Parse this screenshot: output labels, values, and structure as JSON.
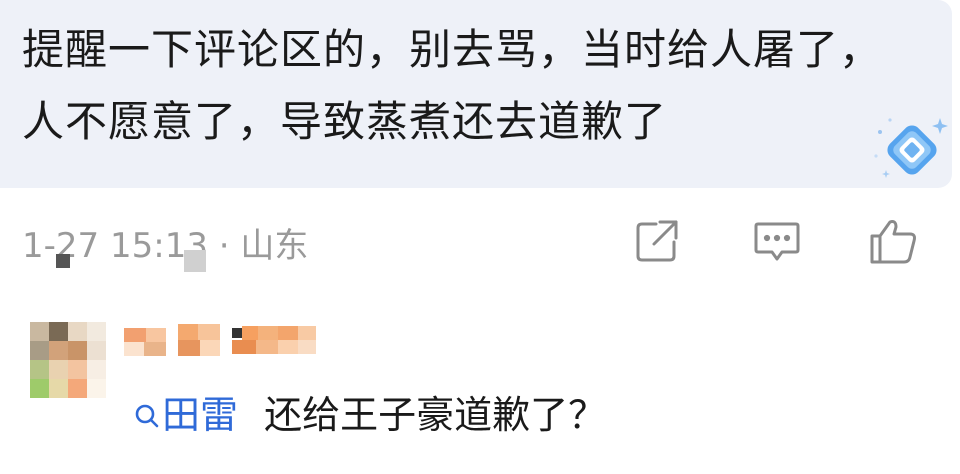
{
  "comment": {
    "text": "提醒一下评论区的，别去骂，当时给人屠了，人不愿意了，导致蒸煮还去道歉了",
    "meta_visible": "1-27 15:13 · 山东",
    "icons": [
      "share-icon",
      "reply-icon",
      "like-icon"
    ]
  },
  "reply": {
    "mention": "田雷",
    "text": "还给王子豪道歉了？"
  },
  "colors": {
    "bubble": "#eef1f8",
    "text": "#1a1a1a",
    "meta": "#9a9a9a",
    "link": "#2f6ad8"
  }
}
